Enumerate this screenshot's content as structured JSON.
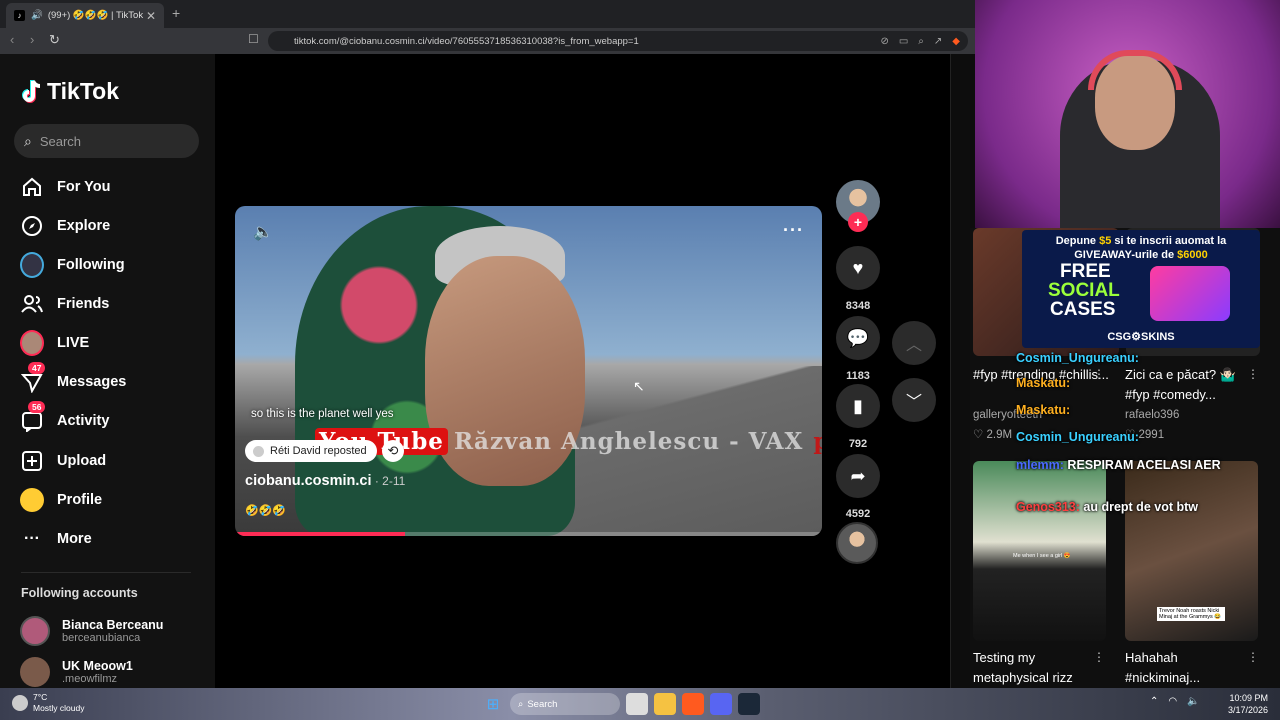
{
  "browser": {
    "tab_title": "(99+) 🤣🤣🤣 | TikTok",
    "new_tab": "+",
    "url": "tiktok.com/@ciobanu.cosmin.ci/video/7605553718536310038?is_from_webapp=1"
  },
  "sidebar": {
    "logo": "TikTok",
    "search_placeholder": "Search",
    "items": [
      {
        "label": "For You",
        "icon": "home-icon"
      },
      {
        "label": "Explore",
        "icon": "compass-icon"
      },
      {
        "label": "Following",
        "icon": "following-avatar-icon"
      },
      {
        "label": "Friends",
        "icon": "friends-icon"
      },
      {
        "label": "LIVE",
        "icon": "live-avatar-icon"
      },
      {
        "label": "Messages",
        "icon": "send-icon",
        "badge": "47"
      },
      {
        "label": "Activity",
        "icon": "inbox-icon",
        "badge": "56"
      },
      {
        "label": "Upload",
        "icon": "plus-square-icon"
      },
      {
        "label": "Profile",
        "icon": "profile-emoji-icon"
      },
      {
        "label": "More",
        "icon": "dots-icon"
      }
    ],
    "following_title": "Following accounts",
    "accounts": [
      {
        "name": "Bianca Berceanu",
        "handle": "berceanubianca"
      },
      {
        "name": "UK Meoow1",
        "handle": ".meowfilmz"
      }
    ]
  },
  "video": {
    "caption_overlay": "so this is the planet well yes",
    "watermark_yt": "You Tube",
    "watermark_name": "Răzvan Anghelescu  -  VAX",
    "watermark_pop": "populi",
    "reposted_by": "Réti David reposted",
    "author": "ciobanu.cosmin.ci",
    "date": " · 2-11",
    "description": "🤣🤣🤣",
    "progress": 0.29
  },
  "actions": {
    "likes": "8348",
    "comments": "1183",
    "saves": "792",
    "shares": "4592"
  },
  "right_grid": {
    "items": [
      {
        "title": "#fyp #trending #chillis...",
        "author": "galleryofteeth",
        "likes": "2.9M"
      },
      {
        "title": "Zici ca e păcat? 🤷🏻‍♂️ #fyp #comedy...",
        "author": "rafaelo396",
        "likes": "2991"
      },
      {
        "title": "Testing my metaphysical rizz",
        "author": "",
        "likes": ""
      },
      {
        "title": "Hahahah #nickiminaj...",
        "author": "",
        "likes": ""
      }
    ],
    "thumb3_text": "Me when I see a girl 😍",
    "thumb4_text": "Trevor Noah roasts Nicki Minaj at the Grammys 😂"
  },
  "promo": {
    "line1_a": "Depune ",
    "line1_b": "$5",
    "line1_c": " si te inscrii auomat la",
    "line2_a": "GIVEAWAY-urile de ",
    "line2_b": "$6000",
    "big1": "FREE",
    "big2": "SOCIAL",
    "big3": "CASES",
    "brand": "CSG⚙SKINS"
  },
  "chat": [
    {
      "user": "Cosmin_Ungureanu:",
      "msg": "",
      "color": "#3ad0ff"
    },
    {
      "user": "Maskatu:",
      "msg": "",
      "color": "#ffb020"
    },
    {
      "user": "Maskatu:",
      "msg": "",
      "color": "#ffb020"
    },
    {
      "user": "Cosmin_Ungureanu:",
      "msg": "",
      "color": "#3ad0ff"
    },
    {
      "user": "mlemm:",
      "msg": " RESPIRAM ACELASI AER",
      "color": "#4a6aff"
    },
    {
      "user": "Genos313:",
      "msg": " au drept de vot btw",
      "color": "#ff4040"
    }
  ],
  "taskbar": {
    "temp": "7°C",
    "weather": "Mostly cloudy",
    "search": "Search",
    "time": "10:09 PM",
    "date": "3/17/2026"
  }
}
